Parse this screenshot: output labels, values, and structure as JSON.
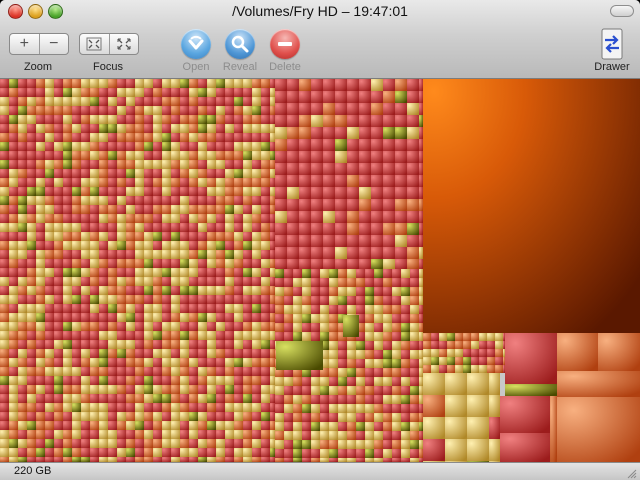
{
  "window": {
    "title": "/Volumes/Fry HD – 19:47:01"
  },
  "toolbar": {
    "zoom_label": "Zoom",
    "zoom_in_glyph": "+",
    "zoom_out_glyph": "−",
    "focus_label": "Focus",
    "open_label": "Open",
    "reveal_label": "Reveal",
    "delete_label": "Delete",
    "drawer_label": "Drawer",
    "icons": {
      "zoom_in": "plus-icon",
      "zoom_out": "minus-icon",
      "focus_in": "focus-in-icon",
      "focus_out": "focus-out-icon",
      "open": "open-arrow-icon",
      "reveal": "magnifier-icon",
      "delete": "delete-minus-icon",
      "drawer": "drawer-arrows-icon"
    }
  },
  "colors": {
    "open_blue": "#5aa6e0",
    "reveal_blue": "#4f97d6",
    "delete_red": "#e0504c",
    "treemap_large_orange": "#c85000",
    "treemap_red": "#d04040",
    "treemap_tan": "#d8b868",
    "treemap_olive": "#808010"
  },
  "status": {
    "size_text": "220 GB"
  }
}
